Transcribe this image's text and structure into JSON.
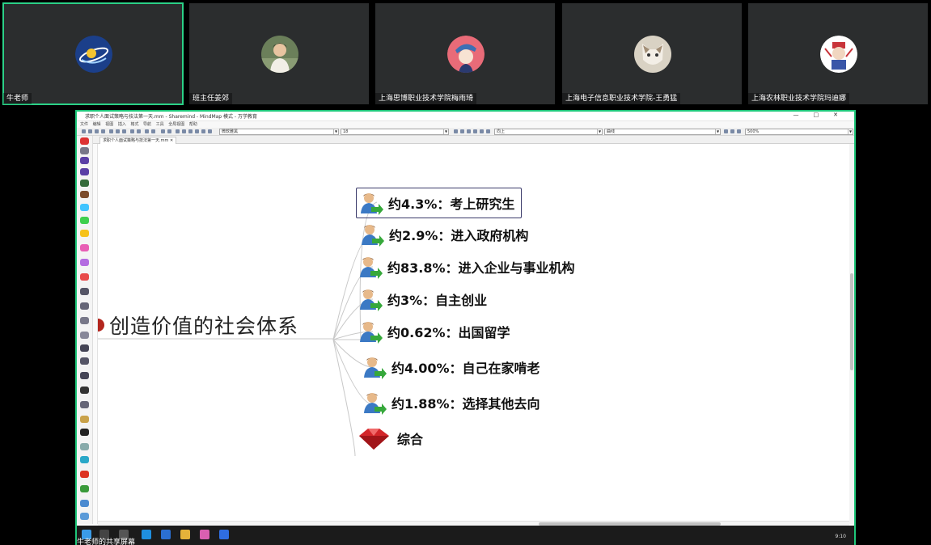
{
  "participants": [
    {
      "name": "牛老师",
      "avatar_icon": "satellite-logo-avatar",
      "active": true
    },
    {
      "name": "班主任姜郊",
      "avatar_icon": "person-photo-avatar",
      "active": false
    },
    {
      "name": "上海思博职业技术学院梅雨琦",
      "avatar_icon": "cartoon-girl-avatar",
      "active": false
    },
    {
      "name": "上海电子信息职业技术学院-王勇猛",
      "avatar_icon": "cat-avatar",
      "active": false
    },
    {
      "name": "上海农林职业技术学院玛迪娜",
      "avatar_icon": "cartoon-character-avatar",
      "active": false
    }
  ],
  "app": {
    "title": "求职个人面试策略与技法第一天.mm - Sharemind - MindMap 模式 - 万学教育",
    "menu": [
      "文件",
      "编辑",
      "视图",
      "插入",
      "格式",
      "导航",
      "工具",
      "全局视图",
      "帮助"
    ],
    "font_combo": "微软雅黑",
    "size_combo": "18",
    "align_combo": "向上",
    "line_combo": "曲线",
    "zoom_combo": "500%",
    "tab_label": "求职个人面试策略与技法第一天.mm"
  },
  "mindmap": {
    "root": "创造价值的社会体系",
    "children": [
      {
        "label": "约4.3%：考上研究生",
        "icon": "person-arrow-icon",
        "selected": true
      },
      {
        "label": "约2.9%：进入政府机构",
        "icon": "person-arrow-icon",
        "selected": false
      },
      {
        "label": "约83.8%：进入企业与事业机构",
        "icon": "person-arrow-icon",
        "selected": false
      },
      {
        "label": "约3%：自主创业",
        "icon": "person-arrow-icon",
        "selected": false
      },
      {
        "label": "约0.62%：出国留学",
        "icon": "person-arrow-icon",
        "selected": false
      },
      {
        "label": "约4.00%：自己在家啃老",
        "icon": "person-arrow-icon",
        "selected": false
      },
      {
        "label": "约1.88%：选择其他去向",
        "icon": "person-arrow-icon",
        "selected": false
      },
      {
        "label": "综合",
        "icon": "red-gem-icon",
        "selected": false
      }
    ]
  },
  "taskbar": {
    "presenter_label": "牛老师的共享屏幕",
    "time": "9:10"
  }
}
